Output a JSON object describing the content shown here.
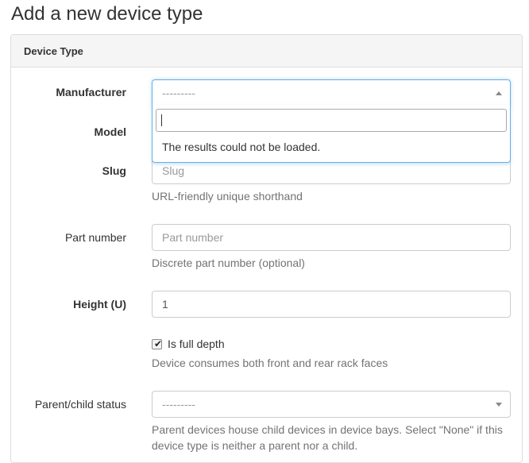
{
  "page": {
    "title": "Add a new device type"
  },
  "panel": {
    "heading": "Device Type"
  },
  "manufacturer": {
    "label": "Manufacturer",
    "value": "---------",
    "dropdown_message": "The results could not be loaded."
  },
  "model": {
    "label": "Model"
  },
  "slug": {
    "label": "Slug",
    "placeholder": "Slug",
    "help": "URL-friendly unique shorthand"
  },
  "part_number": {
    "label": "Part number",
    "placeholder": "Part number",
    "help": "Discrete part number (optional)"
  },
  "height": {
    "label": "Height (U)",
    "value": "1"
  },
  "full_depth": {
    "label": "Is full depth",
    "checked": true,
    "help": "Device consumes both front and rear rack faces"
  },
  "parent_child": {
    "label": "Parent/child status",
    "value": "---------",
    "help": "Parent devices house child devices in device bays. Select \"None\" if this device type is neither a parent nor a child."
  },
  "colors": {
    "focus": "#66afe9",
    "help_text": "#737373",
    "heading_bg": "#f5f5f5"
  }
}
